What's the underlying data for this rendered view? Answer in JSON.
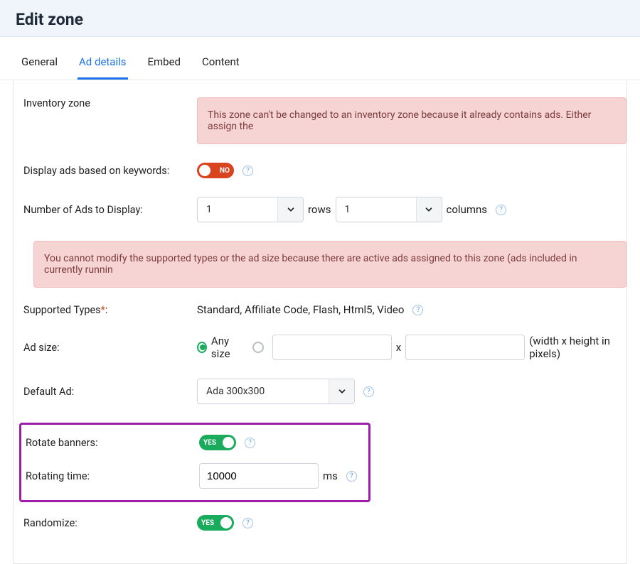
{
  "header": {
    "title": "Edit zone"
  },
  "tabs": {
    "items": [
      {
        "label": "General"
      },
      {
        "label": "Ad details"
      },
      {
        "label": "Embed"
      },
      {
        "label": "Content"
      }
    ],
    "active_index": 1
  },
  "form": {
    "inventory_zone": {
      "label": "Inventory zone",
      "alert": "This zone can't be changed to an inventory zone because it already contains ads. Either assign the"
    },
    "display_keywords": {
      "label": "Display ads based on keywords:",
      "state": "NO"
    },
    "num_ads": {
      "label": "Number of Ads to Display:",
      "rows_value": "1",
      "rows_label": "rows",
      "cols_value": "1",
      "cols_label": "columns"
    },
    "restriction_alert": "You cannot modify the supported types or the ad size because there are active ads assigned to this zone (ads included in currently runnin",
    "supported_types": {
      "label": "Supported Types",
      "required_mark": "*",
      "colon": ":",
      "value": "Standard, Affiliate Code, Flash, Html5, Video"
    },
    "ad_size": {
      "label": "Ad size:",
      "option_any": "Any size",
      "width": "",
      "height": "",
      "x": "x",
      "hint": "(width x height in pixels)"
    },
    "default_ad": {
      "label": "Default Ad:",
      "value": "Ada 300x300"
    },
    "rotate_banners": {
      "label": "Rotate banners:",
      "state": "YES"
    },
    "rotating_time": {
      "label": "Rotating time:",
      "value": "10000",
      "unit": "ms"
    },
    "randomize": {
      "label": "Randomize:",
      "state": "YES"
    }
  },
  "icons": {
    "help": "?",
    "chevron": "v"
  }
}
